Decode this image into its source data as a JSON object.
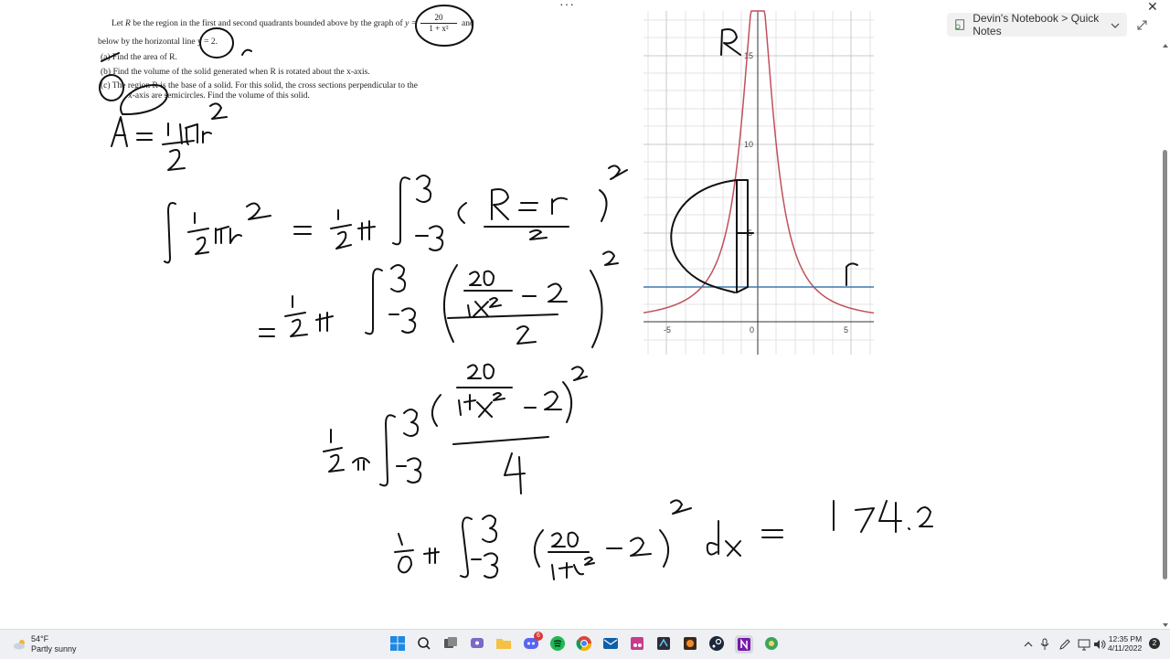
{
  "window": {
    "title_dots": "···",
    "close_glyph": "✕",
    "notebook_location": "Devin's Notebook > Quick Notes"
  },
  "problem": {
    "line1_a": "Let",
    "line1_b": "R",
    "line1_c": "be the region in the first and second quadrants bounded above by the graph of",
    "line1_d": "y =",
    "fraction_num": "20",
    "fraction_den": "1 + x²",
    "line1_e": "and",
    "line2": "below by the horizontal line  y = 2.",
    "part_a": "(a)   Find the area of  R.",
    "part_b": "(b)   Find the volume of the solid generated when  R  is rotated about the x-axis.",
    "part_c1": "(c)   The region  R  is the base of a solid. For this solid, the cross sections perpendicular to the",
    "part_c2": "x-axis are semicircles. Find the volume of this solid."
  },
  "graph": {
    "x_ticks": [
      "-5",
      "0",
      "5"
    ],
    "y_ticks": [
      "5",
      "10",
      "15"
    ],
    "curve_color": "#c0505a",
    "line_color": "#3f78b0",
    "label_upper": "R",
    "label_lower": "r"
  },
  "handwriting": {
    "area_formula": "A = ½πr²",
    "step1": "∫ ½πr² = ½π ∫₋₃³ ((R − r)/2)²",
    "step2": "= ½π ∫₋₃³ ((20/(1+x²) − 2)/2)²",
    "step3": "½π ∫₋₃³ (20/(1+x²) − 2)² / 4",
    "step4": "⅛π ∫₋₃³ (20/(1+x²) − 2)² dx",
    "result": "= 174.2"
  },
  "taskbar": {
    "temperature": "54°F",
    "weather": "Partly sunny",
    "time": "12:35 PM",
    "date": "4/11/2022",
    "notification_count": "2",
    "discord_badge": "6",
    "apps": [
      "start-icon",
      "search-icon",
      "task-view-icon",
      "chat-icon",
      "file-explorer-icon",
      "discord-icon",
      "spotify-icon",
      "chrome-icon",
      "mail-icon",
      "snipping-icon",
      "app-icon",
      "app-icon",
      "steam-icon",
      "onenote-icon",
      "app-icon"
    ]
  }
}
